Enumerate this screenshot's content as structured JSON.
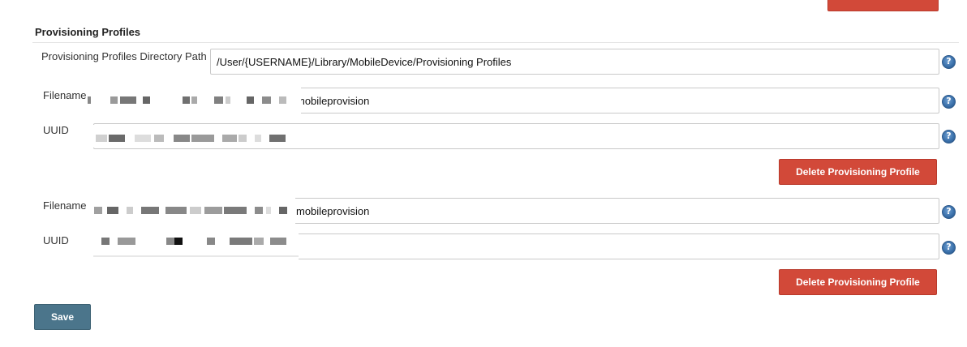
{
  "section": {
    "title": "Provisioning Profiles",
    "directory_label": "Provisioning Profiles Directory Path",
    "directory_value": "/User/{USERNAME}/Library/MobileDevice/Provisioning Profiles"
  },
  "profiles": [
    {
      "filename_label": "Filename",
      "filename_suffix": "mobileprovision",
      "uuid_label": "UUID",
      "delete_label": "Delete Provisioning Profile"
    },
    {
      "filename_label": "Filename",
      "filename_suffix": "mobileprovision",
      "uuid_label": "UUID",
      "delete_label": "Delete Provisioning Profile"
    }
  ],
  "help_glyph": "?",
  "save_label": "Save",
  "colors": {
    "delete_button": "#d24939",
    "save_button": "#4b758b",
    "help_icon": "#386ea8"
  },
  "icons": [
    "help-icon",
    "help-icon",
    "help-icon",
    "help-icon",
    "help-icon"
  ]
}
